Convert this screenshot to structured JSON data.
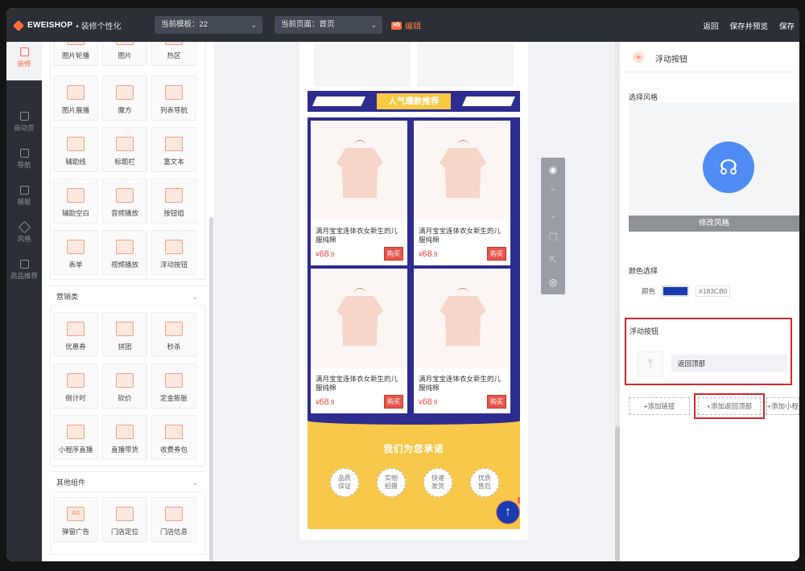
{
  "topbar": {
    "logo_text": "EWEISHOP",
    "logo_sub": "• 装修个性化",
    "template_select": "当前模板：22",
    "page_select": "当前页面：首页",
    "edit_badge": "H5",
    "edit_label": "编辑",
    "back": "返回",
    "save_preview": "保存并预览",
    "save": "保存"
  },
  "rail": [
    {
      "label": "装修",
      "icon": "paintbrush-icon"
    },
    {
      "label": "启动页",
      "icon": "document-icon"
    },
    {
      "label": "导航",
      "icon": "grid-icon"
    },
    {
      "label": "模板",
      "icon": "template-icon"
    },
    {
      "label": "风格",
      "icon": "droplet-icon"
    },
    {
      "label": "商品推荐",
      "icon": "clipboard-icon"
    }
  ],
  "components": {
    "basic_top": [
      "图片轮播",
      "图片",
      "热区"
    ],
    "basic": [
      {
        "label": "图片展播",
        "icon": "image-gallery-icon"
      },
      {
        "label": "魔方",
        "icon": "cube-icon"
      },
      {
        "label": "列表导航",
        "icon": "list-nav-icon"
      },
      {
        "label": "辅助线",
        "icon": "divider-line-icon"
      },
      {
        "label": "标题栏",
        "icon": "title-bar-icon"
      },
      {
        "label": "富文本",
        "icon": "rich-text-icon"
      },
      {
        "label": "辅助空白",
        "icon": "blank-space-icon"
      },
      {
        "label": "音频播放",
        "icon": "music-note-icon"
      },
      {
        "label": "按钮组",
        "icon": "button-group-icon"
      },
      {
        "label": "表单",
        "icon": "form-icon"
      },
      {
        "label": "视频播放",
        "icon": "video-play-icon"
      },
      {
        "label": "浮动按钮",
        "icon": "floating-button-icon"
      }
    ],
    "marketing_title": "营销类",
    "marketing": [
      {
        "label": "优惠券",
        "icon": "coupon-icon"
      },
      {
        "label": "拼团",
        "icon": "group-buy-icon"
      },
      {
        "label": "秒杀",
        "icon": "flash-sale-icon"
      },
      {
        "label": "倒计时",
        "icon": "countdown-icon"
      },
      {
        "label": "砍价",
        "icon": "bargain-icon"
      },
      {
        "label": "定金膨胀",
        "icon": "deposit-icon"
      },
      {
        "label": "小程序直播",
        "icon": "mini-live-icon"
      },
      {
        "label": "直播带货",
        "icon": "live-shopping-icon"
      },
      {
        "label": "收费券包",
        "icon": "coupon-pack-icon"
      }
    ],
    "other_title": "其他组件",
    "other": [
      {
        "label": "弹窗广告",
        "icon": "popup-ad-icon",
        "text": "AD"
      },
      {
        "label": "门店定位",
        "icon": "map-pin-icon"
      },
      {
        "label": "门店信息",
        "icon": "store-icon"
      }
    ]
  },
  "canvas": {
    "hot_title": "人气爆款推荐",
    "products": [
      {
        "title": "满月宝宝连体衣女新生的儿服纯棉",
        "currency": "¥",
        "price_int": "68",
        "price_dec": ".9",
        "buy": "购买"
      },
      {
        "title": "满月宝宝连体衣女新生的儿服纯棉",
        "currency": "¥",
        "price_int": "68",
        "price_dec": ".9",
        "buy": "购买"
      },
      {
        "title": "满月宝宝连体衣女新生的儿服纯棉",
        "currency": "¥",
        "price_int": "68",
        "price_dec": ".9",
        "buy": "购买"
      },
      {
        "title": "满月宝宝连体衣女新生的儿服纯棉",
        "currency": "¥",
        "price_int": "68",
        "price_dec": ".9",
        "buy": "购买"
      }
    ],
    "promise_title": "我们为您承诺",
    "promises": [
      "品质保证",
      "实物拍摄",
      "快速发货",
      "优质售后"
    ],
    "float_glyph": "↑",
    "float_close": "×"
  },
  "tools": [
    "eye-icon",
    "arrow-up-icon",
    "arrow-down-icon",
    "copy-icon",
    "share-icon",
    "settings-icon"
  ],
  "right_panel": {
    "title": "浮动按钮",
    "style_label": "选择风格",
    "modify_style": "修改风格",
    "color_label": "颜色选择",
    "color_field": "颜色",
    "color_value": "#183CB0",
    "float_label": "浮动按钮",
    "back_top": "返回顶部",
    "add_link": "+添加链接",
    "add_back_top": "+添加返回顶部",
    "add_mini": "+添加小程"
  },
  "colors": {
    "accent": "#ff6a3d",
    "float_button": "#183CB0",
    "banner": "#2e2c8f",
    "promise_bg": "#f8c84a"
  }
}
